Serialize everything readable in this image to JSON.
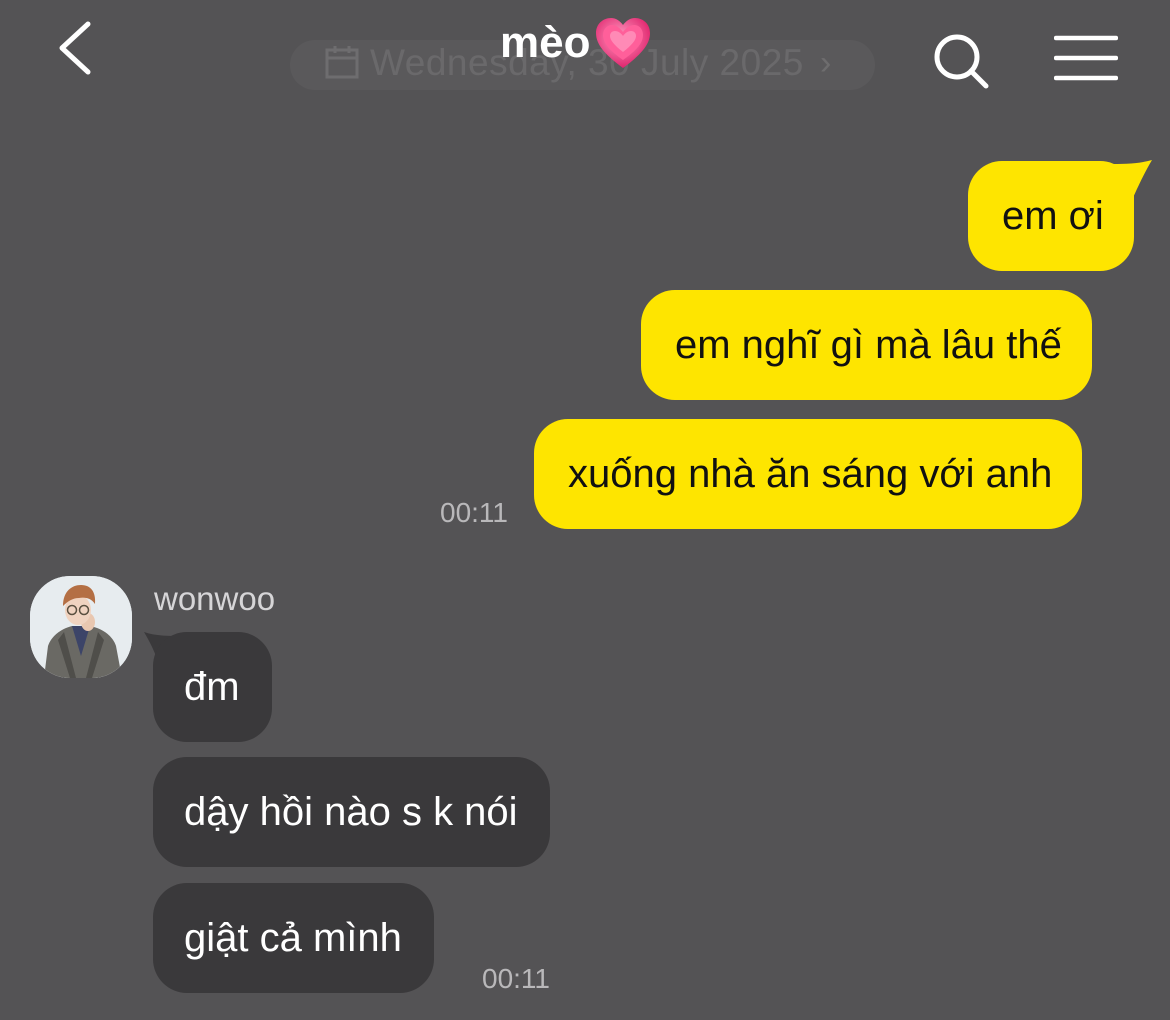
{
  "header": {
    "title": "mèo",
    "date": "Wednesday, 30 July 2025",
    "back_icon": "chevron-left-icon",
    "title_icon": "growing-heart-icon",
    "search_icon": "search-icon",
    "menu_icon": "hamburger-menu-icon"
  },
  "colors": {
    "background": "#545355",
    "my_bubble": "#fee500",
    "their_bubble": "#3a393b",
    "timestamp": "#b9b8ba"
  },
  "outgoing": {
    "messages": [
      {
        "text": "em ơi"
      },
      {
        "text": "em nghĩ gì mà lâu thế"
      },
      {
        "text": "xuống nhà ăn sáng với anh"
      }
    ],
    "time": "00:11"
  },
  "incoming": {
    "sender": "wonwoo",
    "messages": [
      {
        "text": "đm"
      },
      {
        "text": "dậy hồi nào s k nói"
      },
      {
        "text": "giật cả mình"
      }
    ],
    "time": "00:11"
  }
}
